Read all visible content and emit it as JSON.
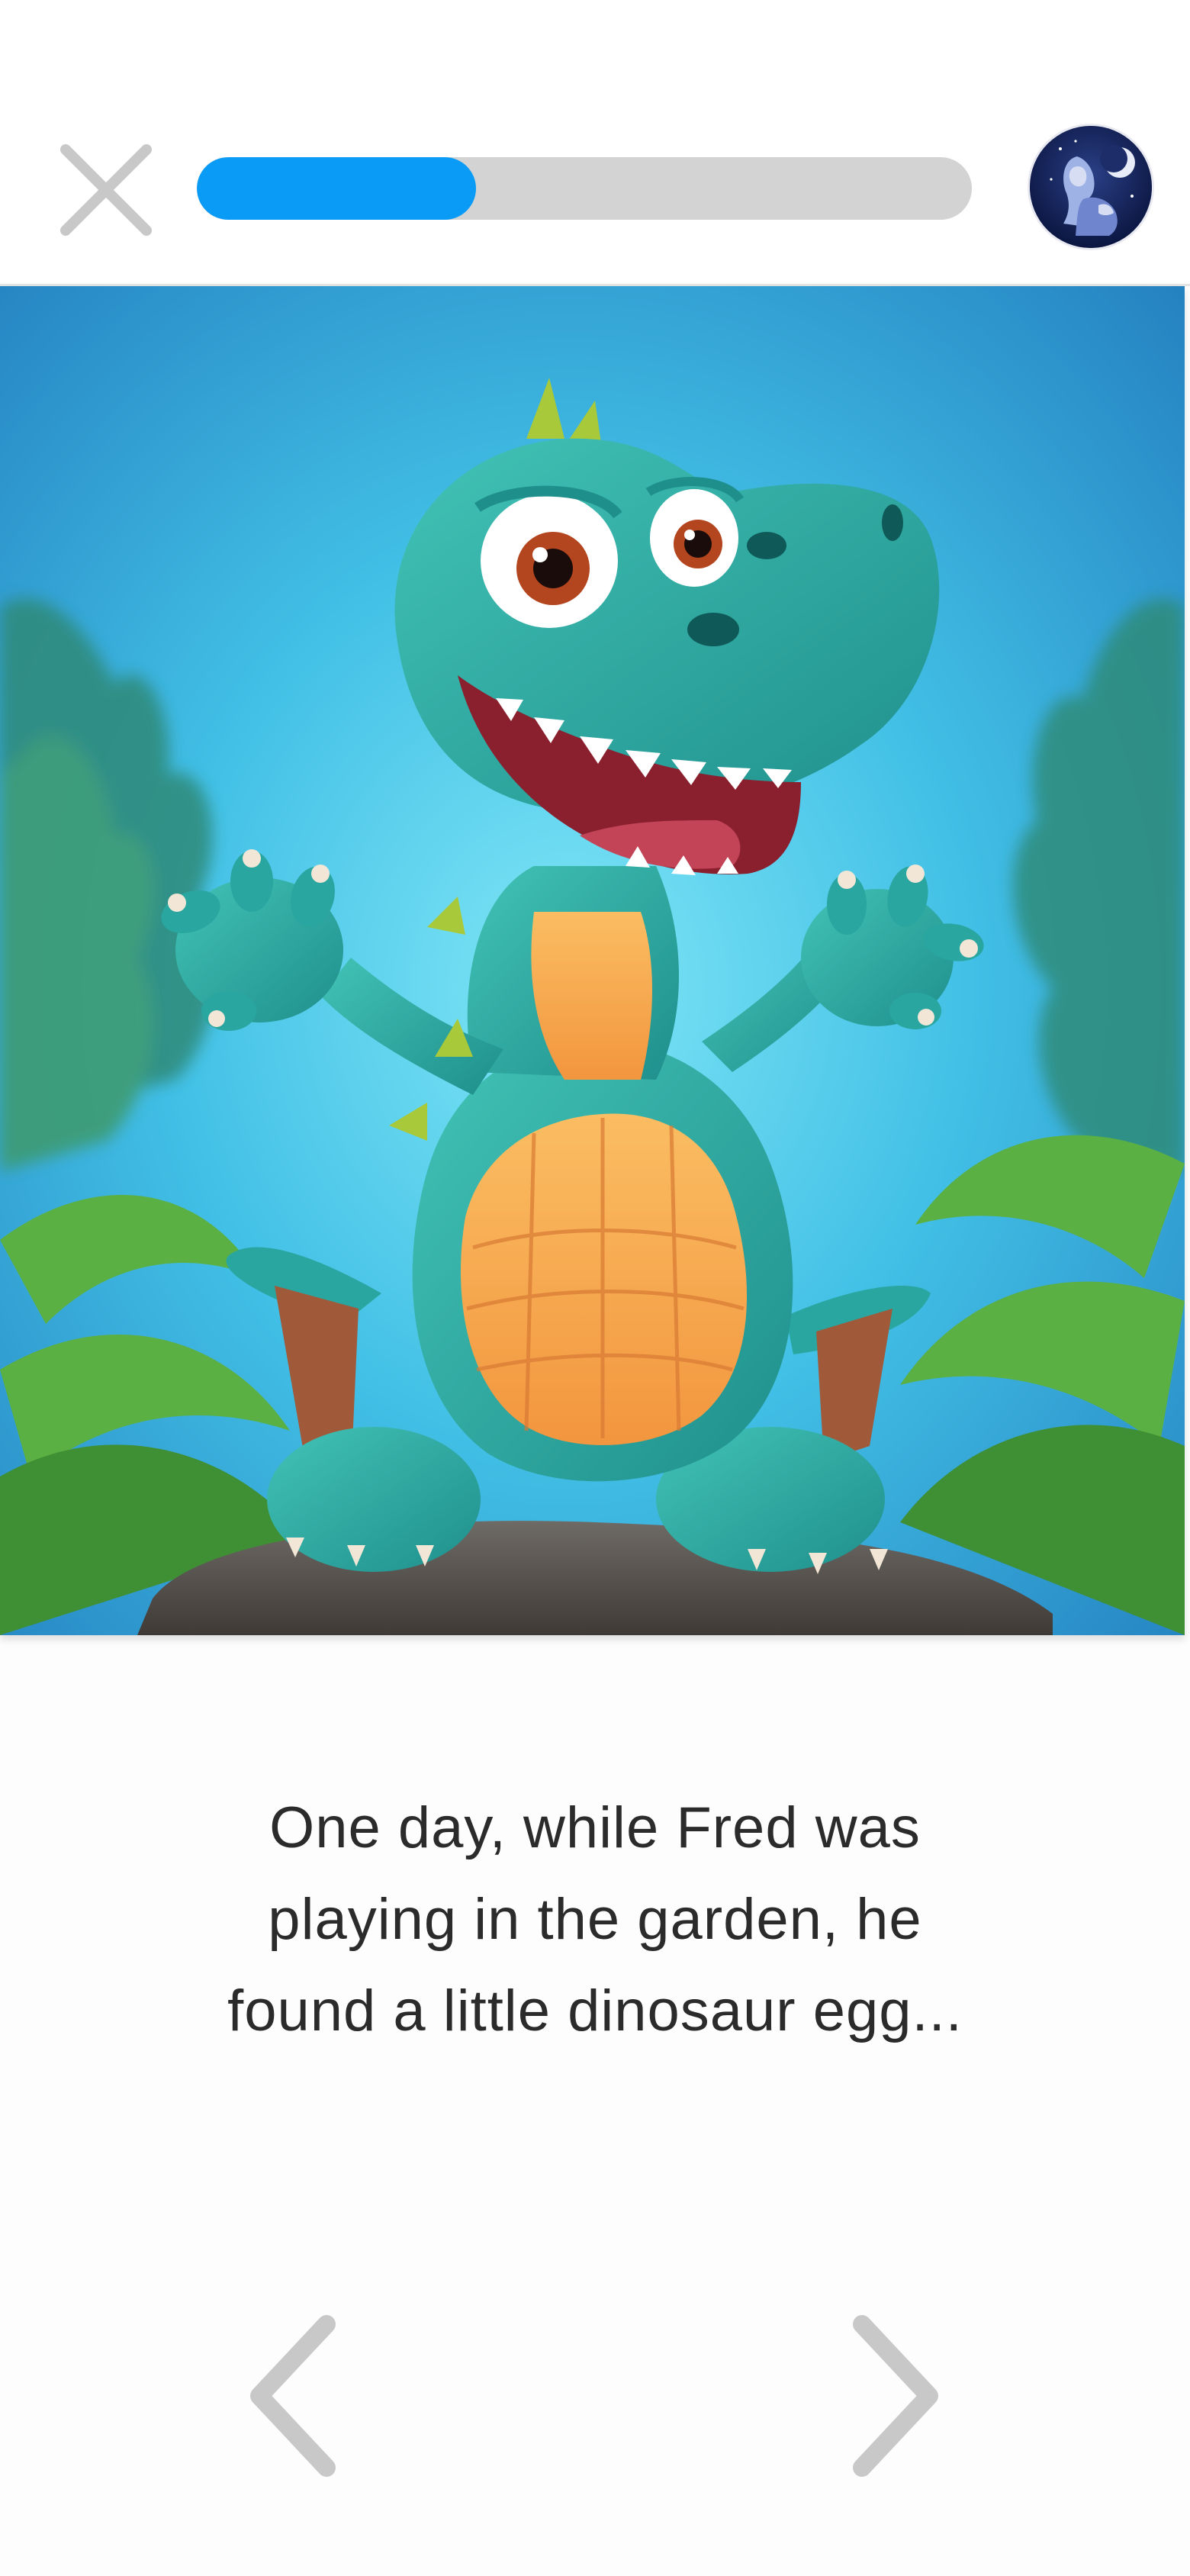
{
  "header": {
    "close_icon": "close-icon",
    "progress_percent": 36,
    "progress_color": "#0a9bf6",
    "progress_track_color": "#d3d3d3",
    "avatar_icon": "storyteller-avatar"
  },
  "page": {
    "illustration_icon": "cartoon-dinosaur-illustration",
    "text": "One day, while Fred was playing in the garden, he found a little dinosaur egg...",
    "text_lines": [
      "One day, while Fred was",
      "playing in the garden, he",
      "found a little dinosaur egg..."
    ]
  },
  "navigation": {
    "prev_icon": "chevron-left-icon",
    "next_icon": "chevron-right-icon"
  }
}
